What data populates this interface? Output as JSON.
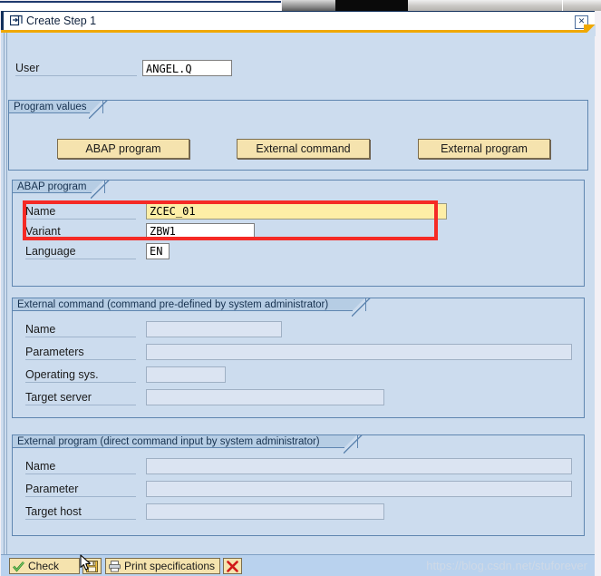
{
  "window": {
    "title": "Create Step  1",
    "title_icon": "window-restore-icon",
    "close_label": "✕"
  },
  "user": {
    "label": "User",
    "value": "ANGEL.Q"
  },
  "program_values": {
    "title": "Program values",
    "buttons": [
      {
        "name": "abap-program",
        "label": "ABAP program"
      },
      {
        "name": "external-command",
        "label": "External command"
      },
      {
        "name": "external-program",
        "label": "External program"
      }
    ]
  },
  "abap_program": {
    "title": "ABAP program",
    "fields": [
      {
        "name": "name",
        "label": "Name",
        "value": "ZCEC_01",
        "state": "required"
      },
      {
        "name": "variant",
        "label": "Variant",
        "value": "ZBW1",
        "state": "editable"
      },
      {
        "name": "language",
        "label": "Language",
        "value": "EN",
        "state": "editable"
      }
    ],
    "highlight_color": "#f52a25"
  },
  "external_command": {
    "title": "External command (command pre-defined by system administrator)",
    "fields": [
      {
        "name": "name",
        "label": "Name",
        "value": "",
        "state": "disabled"
      },
      {
        "name": "parameters",
        "label": "Parameters",
        "value": "",
        "state": "disabled"
      },
      {
        "name": "operating-sys",
        "label": "Operating sys.",
        "value": "",
        "state": "disabled"
      },
      {
        "name": "target-server",
        "label": "Target server",
        "value": "",
        "state": "disabled"
      }
    ]
  },
  "external_program": {
    "title": "External program (direct command input by system administrator)",
    "fields": [
      {
        "name": "name",
        "label": "Name",
        "value": "",
        "state": "disabled"
      },
      {
        "name": "parameter",
        "label": "Parameter",
        "value": "",
        "state": "disabled"
      },
      {
        "name": "target-host",
        "label": "Target host",
        "value": "",
        "state": "disabled"
      }
    ]
  },
  "toolbar": {
    "check_label": "Check",
    "check_icon": "green-check-icon",
    "save_icon": "floppy-save-icon",
    "print_label": "Print specifications",
    "print_icon": "printer-icon",
    "cancel_icon": "red-x-icon"
  },
  "watermark": "https://blog.csdn.net/stuforever",
  "colors": {
    "window_bg": "#ccdcee",
    "group_header": "#b6cde4",
    "button_face": "#f5e3ae",
    "required_field": "#fdeea6",
    "disabled_field": "#dbe4f2",
    "accent_underline": "#f0a800",
    "highlight_red": "#f52a25"
  }
}
